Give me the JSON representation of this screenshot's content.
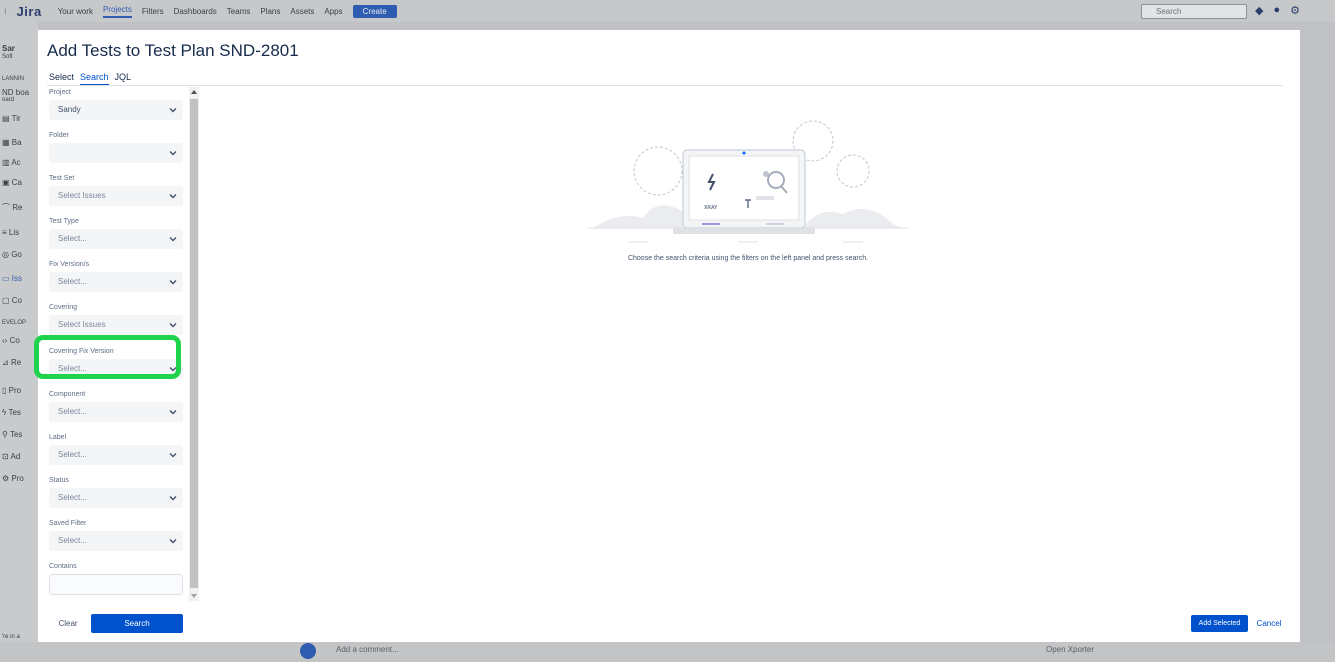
{
  "background": {
    "logo": "Jira",
    "nav": [
      "Your work",
      "Projects",
      "Filters",
      "Dashboards",
      "Teams",
      "Plans",
      "Assets",
      "Apps"
    ],
    "active_nav": "Projects",
    "create_label": "Create",
    "search_placeholder": "Search",
    "sidebar": {
      "project_name": "Sar",
      "project_type": "Soft",
      "section_planning": "LANNIN",
      "board_name": "ND boa",
      "board_sub": "oard",
      "items": [
        "Tir",
        "Ba",
        "Ac",
        "Ca",
        "Re",
        "Lis",
        "Go",
        "Iss",
        "Co"
      ],
      "section_development": "EVELOP",
      "dev_items": [
        "Co",
        "Re",
        "Pro",
        "Tes",
        "Tes",
        "Ad",
        "Pro"
      ],
      "footer": "'re in a"
    },
    "bottom_comment": "Add a comment...",
    "bottom_right": "Open Xporter"
  },
  "modal": {
    "title": "Add Tests to Test Plan SND-2801",
    "tabs": [
      {
        "label": "Select",
        "active": false
      },
      {
        "label": "Search",
        "active": true
      },
      {
        "label": "JQL",
        "active": false
      }
    ],
    "filters": [
      {
        "label": "Project",
        "value": "Sandy",
        "placeholder": false
      },
      {
        "label": "Folder",
        "value": "",
        "placeholder": false
      },
      {
        "label": "Test Set",
        "value": "Select Issues",
        "placeholder": true
      },
      {
        "label": "Test Type",
        "value": "Select...",
        "placeholder": true
      },
      {
        "label": "Fix Version/s",
        "value": "Select...",
        "placeholder": true
      },
      {
        "label": "Covering",
        "value": "Select Issues",
        "placeholder": true
      },
      {
        "label": "Covering Fix Version",
        "value": "Select...",
        "placeholder": true
      },
      {
        "label": "Component",
        "value": "Select...",
        "placeholder": true
      },
      {
        "label": "Label",
        "value": "Select...",
        "placeholder": true
      },
      {
        "label": "Status",
        "value": "Select...",
        "placeholder": true
      },
      {
        "label": "Saved Filter",
        "value": "Select...",
        "placeholder": true
      }
    ],
    "contains_label": "Contains",
    "contains_value": "",
    "illustration_label": "XRAY",
    "empty_message": "Choose the search criteria using the filters on the left panel and press search.",
    "clear_label": "Clear",
    "search_label": "Search",
    "add_selected_label": "Add Selected",
    "cancel_label": "Cancel",
    "highlight_color": "#1fd34c",
    "accent_color": "#0052cc"
  }
}
